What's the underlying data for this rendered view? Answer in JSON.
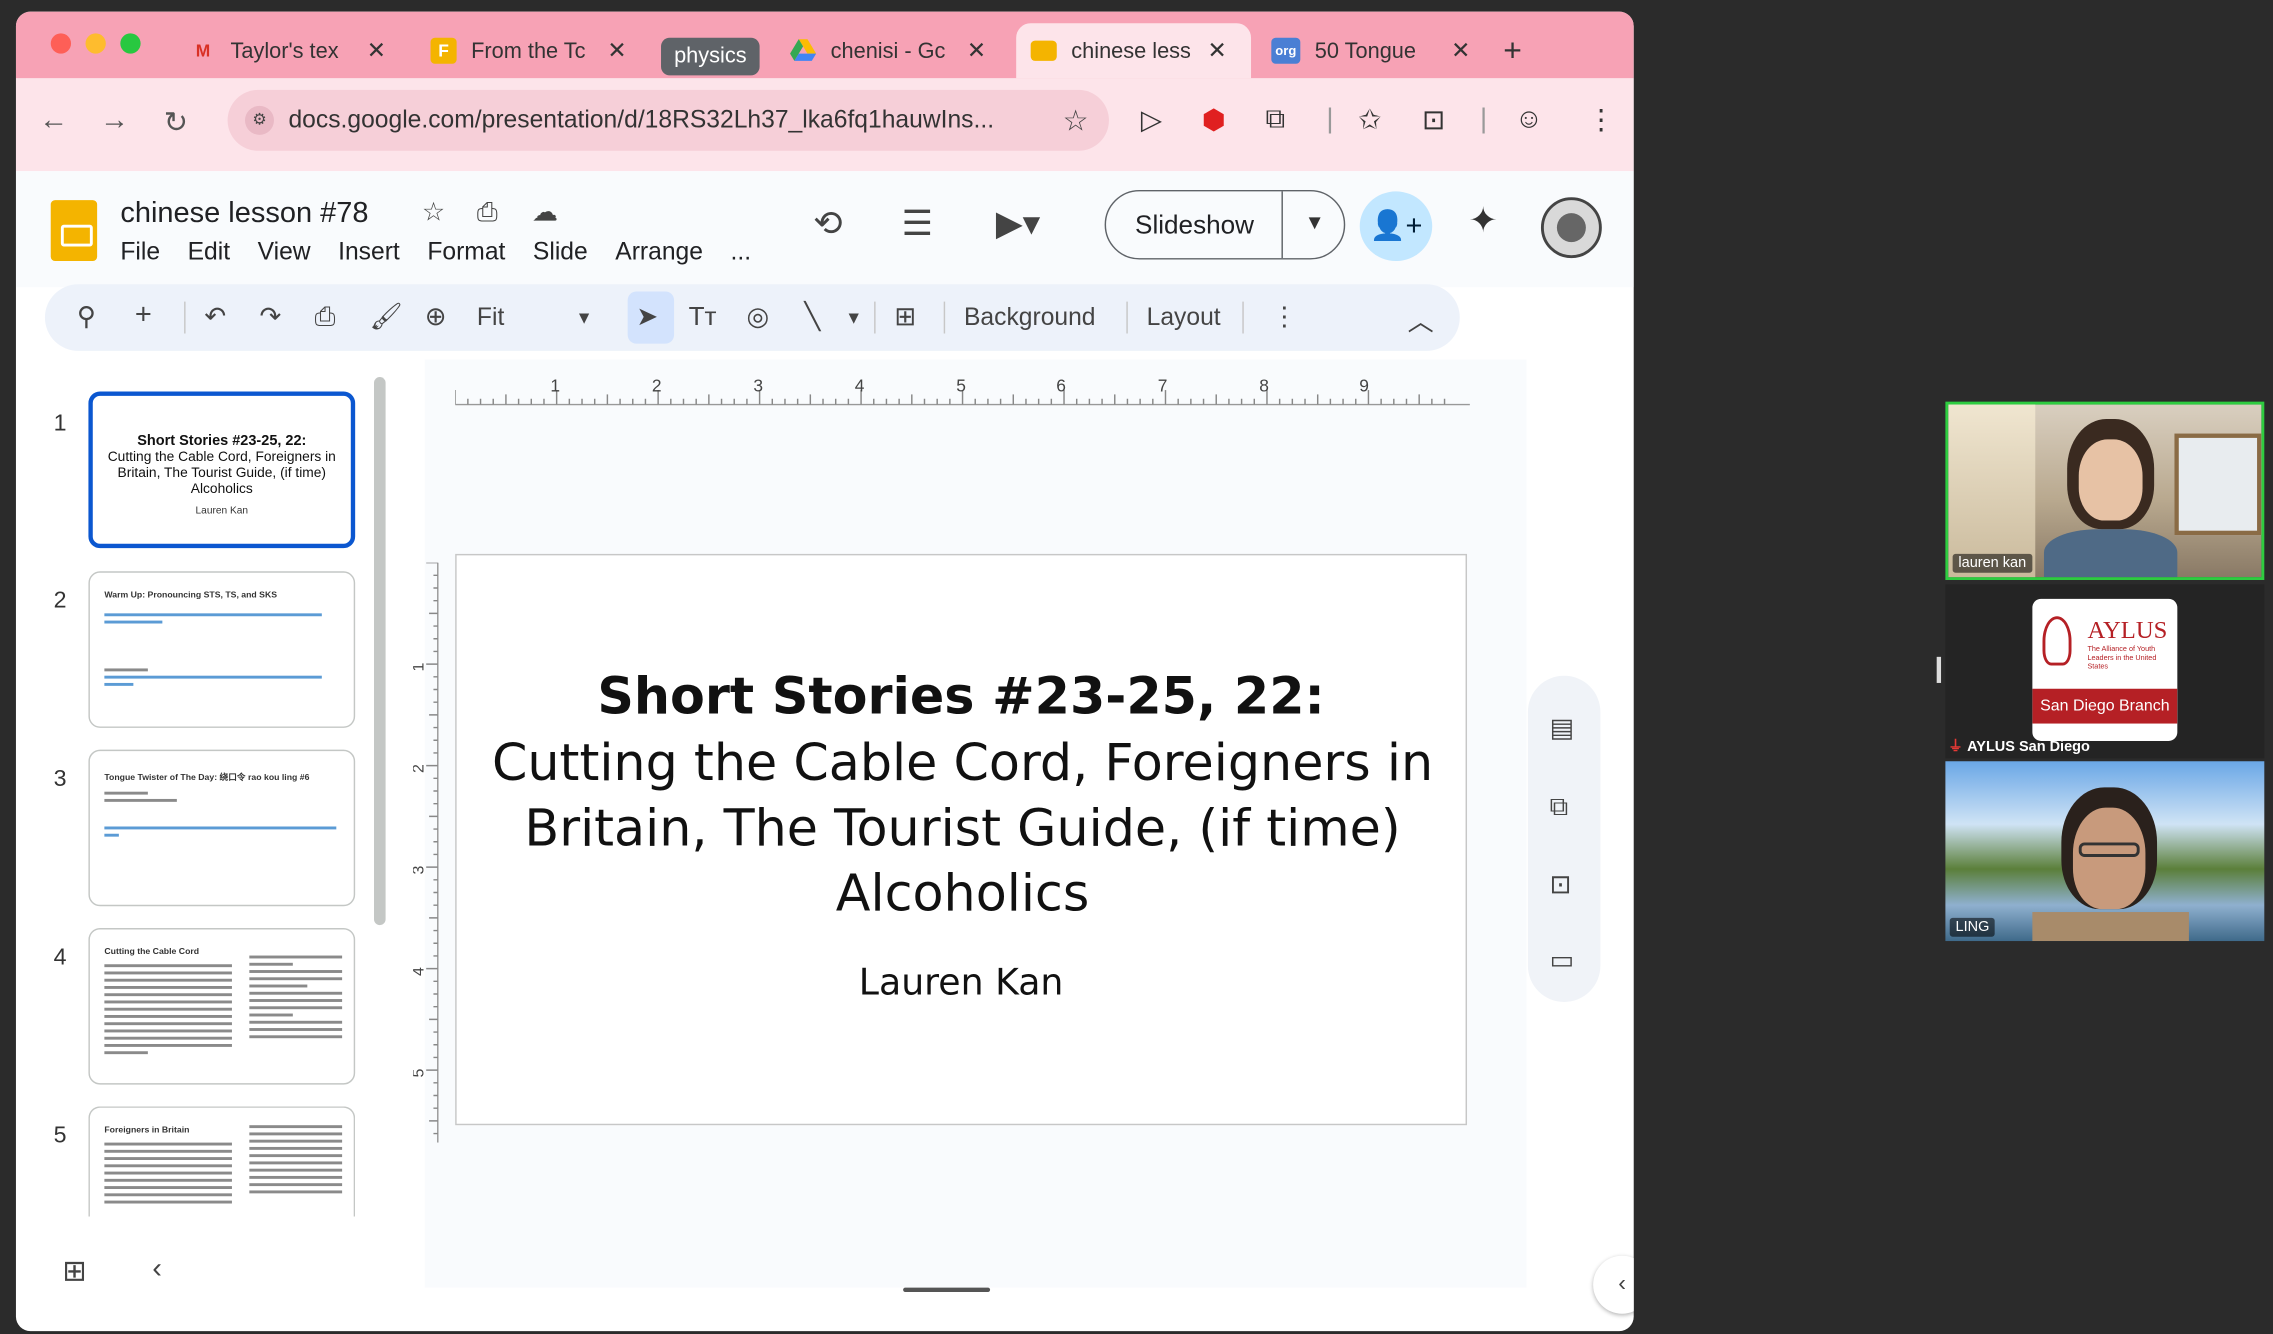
{
  "browser": {
    "tabs": [
      {
        "label": "Taylor's tex",
        "icon": "gmail-icon"
      },
      {
        "label": "From the Tc",
        "icon": "docs-icon"
      },
      {
        "label": "chenisi - Gc",
        "icon": "drive-icon"
      },
      {
        "label": "chinese less",
        "icon": "slides-icon"
      },
      {
        "label": "50 Tongue",
        "icon": "link-icon"
      }
    ],
    "tab_group": "physics",
    "url": "docs.google.com/presentation/d/18RS32Lh37_lka6fq1hauwIns..."
  },
  "doc": {
    "title": "chinese lesson #78",
    "menu": [
      "File",
      "Edit",
      "View",
      "Insert",
      "Format",
      "Slide",
      "Arrange",
      "..."
    ],
    "slideshow_label": "Slideshow"
  },
  "toolbar": {
    "zoom": "Fit",
    "background": "Background",
    "layout": "Layout"
  },
  "filmstrip": {
    "slides": [
      {
        "num": "1",
        "title": "Short Stories #23-25, 22:",
        "subtitle": "Cutting the Cable Cord, Foreigners in Britain, The Tourist Guide, (if time) Alcoholics",
        "author": "Lauren Kan"
      },
      {
        "num": "2",
        "title": "Warm Up: Pronouncing STS, TS, and SKS"
      },
      {
        "num": "3",
        "title": "Tongue Twister of The Day: 绕口令 rao kou ling #6"
      },
      {
        "num": "4",
        "title": "Cutting the Cable Cord"
      },
      {
        "num": "5",
        "title": "Foreigners in Britain"
      }
    ]
  },
  "slide": {
    "title": "Short Stories #23-25, 22:",
    "subtitle": "Cutting the Cable Cord, Foreigners in Britain, The Tourist Guide, (if time) Alcoholics",
    "author": "Lauren Kan"
  },
  "ruler": {
    "h": [
      "1",
      "2",
      "3",
      "4",
      "5",
      "6",
      "7",
      "8",
      "9"
    ],
    "v": [
      "1",
      "2",
      "3",
      "4",
      "5"
    ]
  },
  "video": {
    "participants": [
      {
        "name": "lauren kan"
      },
      {
        "name": "AYLUS San Diego",
        "logo_text": "AYLUS",
        "tagline": "The Alliance of Youth Leaders in the United States",
        "branch": "San Diego Branch"
      },
      {
        "name": "LING"
      }
    ]
  },
  "colors": {
    "tab_bar": "#f7a2b5",
    "accent": "#0b57d0",
    "share": "#c2e7ff",
    "aylus_red": "#b52025"
  }
}
